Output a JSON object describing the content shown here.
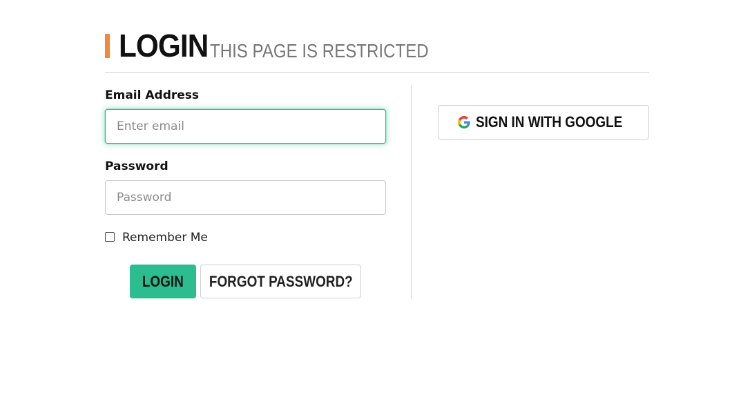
{
  "header": {
    "title": "LOGIN",
    "subtitle": "THIS PAGE IS RESTRICTED"
  },
  "form": {
    "email": {
      "label": "Email Address",
      "placeholder": "Enter email",
      "value": ""
    },
    "password": {
      "label": "Password",
      "placeholder": "Password",
      "value": ""
    },
    "remember": {
      "label": "Remember Me",
      "checked": false
    },
    "login_button": "LOGIN",
    "forgot_button": "FORGOT PASSWORD?"
  },
  "social": {
    "google_button": "SIGN IN WITH GOOGLE",
    "icon": "google-icon"
  },
  "colors": {
    "accent": "#ef8a3a",
    "primary": "#2bbd8e",
    "focus_border": "#2bbd8e",
    "subtitle": "#777777",
    "border": "#cfcfcf"
  }
}
